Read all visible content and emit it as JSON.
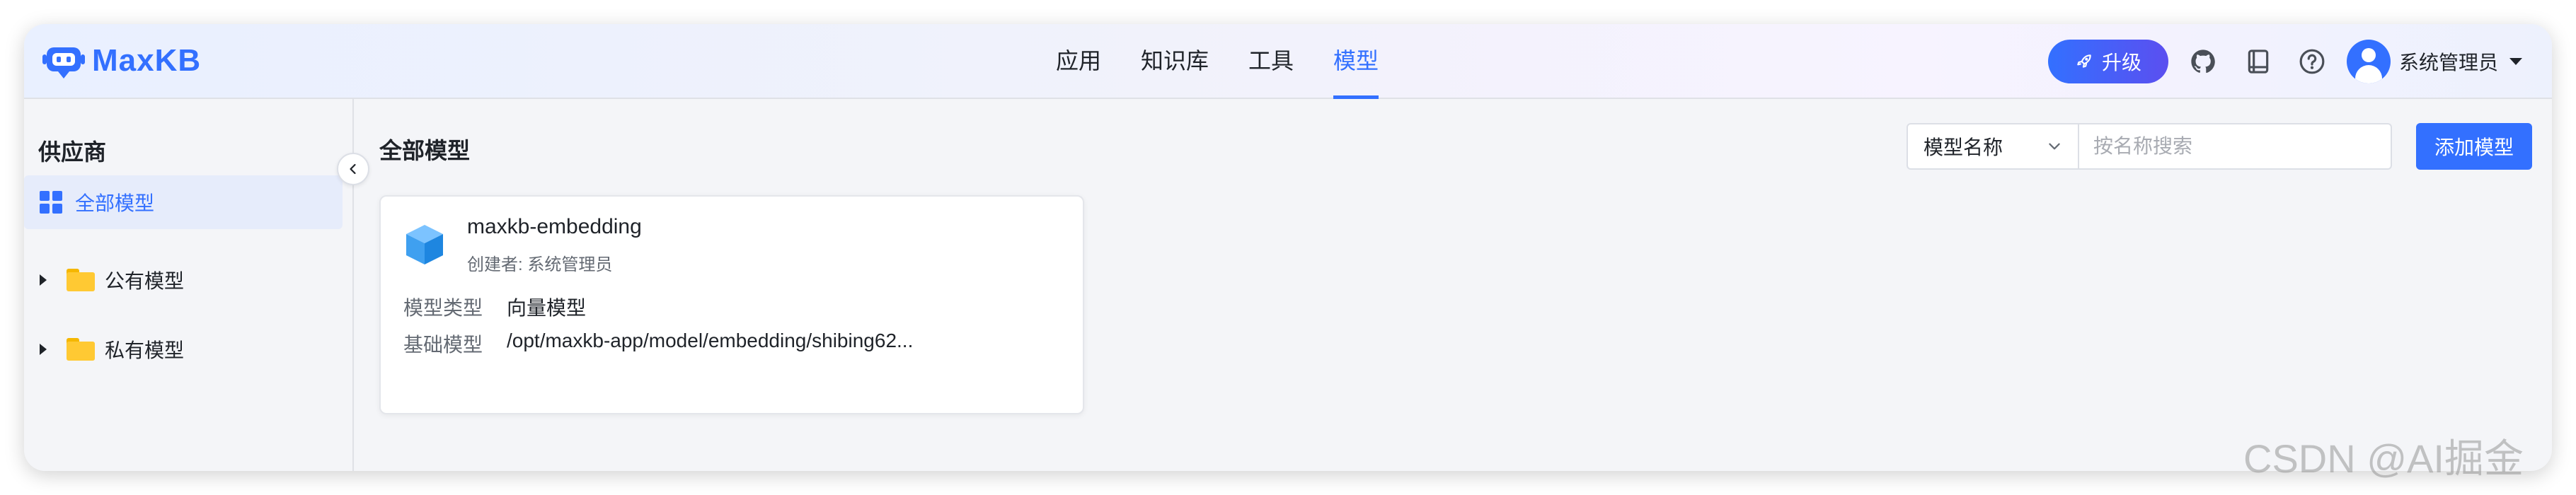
{
  "app": {
    "name": "MaxKB"
  },
  "nav": {
    "items": [
      "应用",
      "知识库",
      "工具",
      "模型"
    ],
    "active_index": 3
  },
  "header": {
    "upgrade_label": "升级",
    "icons": [
      "github-icon",
      "book-icon",
      "help-icon"
    ],
    "user_name": "系统管理员"
  },
  "sidebar": {
    "title": "供应商",
    "all_label": "全部模型",
    "tree": [
      {
        "label": "公有模型"
      },
      {
        "label": "私有模型"
      }
    ]
  },
  "main": {
    "title": "全部模型",
    "search_field": "模型名称",
    "search_placeholder": "按名称搜索",
    "add_label": "添加模型"
  },
  "models": [
    {
      "name": "maxkb-embedding",
      "creator": "创建者: 系统管理员",
      "type_key": "模型类型",
      "type_value": "向量模型",
      "base_key": "基础模型",
      "base_value": "/opt/maxkb-app/model/embedding/shibing62..."
    }
  ],
  "watermark": "CSDN @AI掘金",
  "colors": {
    "accent": "#3370ff",
    "folder": "#ffc933",
    "cube": "#3fa0f0"
  }
}
